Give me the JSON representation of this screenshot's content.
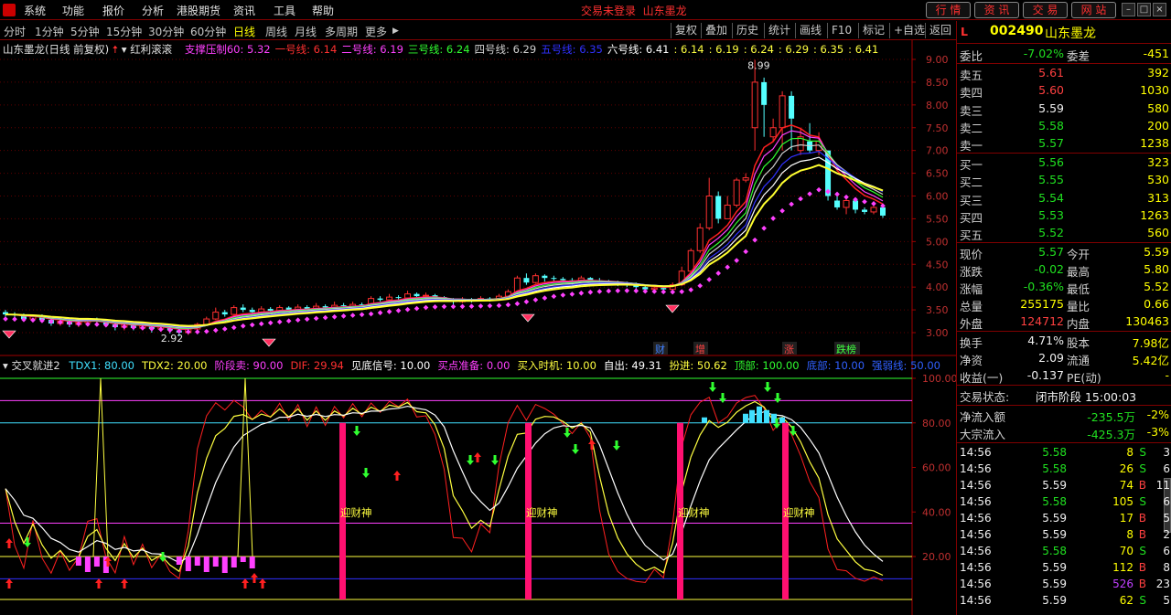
{
  "menu": [
    "系统",
    "功能",
    "报价",
    "分析",
    "港股期货",
    "资讯",
    "工具",
    "帮助"
  ],
  "login_status": "交易未登录",
  "login_stock": "山东墨龙",
  "top_buttons": [
    "行 情",
    "资 讯",
    "交 易",
    "网 站"
  ],
  "periods": [
    "分时",
    "1分钟",
    "5分钟",
    "15分钟",
    "30分钟",
    "60分钟",
    "日线",
    "周线",
    "月线",
    "多周期",
    "更多"
  ],
  "active_period": "日线",
  "tools": [
    "复权",
    "叠加",
    "历史",
    "统计",
    "画线",
    "F10",
    "标记",
    "+自选",
    "返回"
  ],
  "main_legend": {
    "name": "山东墨龙(日线 前复权)",
    "indicator": "红利滚滚",
    "items": [
      {
        "text": "支撑压制60: 5.32",
        "color": "#ff40ff"
      },
      {
        "text": "一号线: 6.14",
        "color": "#ff3030"
      },
      {
        "text": "二号线: 6.19",
        "color": "#ff40ff"
      },
      {
        "text": "三号线: 6.24",
        "color": "#30ff30"
      },
      {
        "text": "四号线: 6.29",
        "color": "#d0d0d0"
      },
      {
        "text": "五号线: 6.35",
        "color": "#3030ff"
      },
      {
        "text": "六号线: 6.41",
        "color": "#ffffff"
      },
      {
        "text": ": 6.14",
        "color": "#ffff40"
      },
      {
        "text": ": 6.19",
        "color": "#ffff40"
      },
      {
        "text": ": 6.24",
        "color": "#ffff40"
      },
      {
        "text": ": 6.29",
        "color": "#ffff40"
      },
      {
        "text": ": 6.35",
        "color": "#ffff40"
      },
      {
        "text": ": 6.41",
        "color": "#ffff40"
      }
    ]
  },
  "price_axis": [
    "9.00",
    "8.50",
    "8.00",
    "7.50",
    "7.00",
    "6.50",
    "6.00",
    "5.50",
    "5.00",
    "4.50",
    "4.00",
    "3.50",
    "3.00"
  ],
  "high_label": "8.99",
  "low_label": "2.92",
  "event_tags": [
    {
      "text": "财",
      "color": "#4080ff"
    },
    {
      "text": "增",
      "color": "#ff4040"
    },
    {
      "text": "涨",
      "color": "#ff4040"
    },
    {
      "text": "跌榜",
      "color": "#40ff40"
    }
  ],
  "sub_legend": {
    "name": "交叉就进2",
    "items": [
      {
        "text": "TDX1: 80.00",
        "color": "#40e0ff"
      },
      {
        "text": "TDX2: 20.00",
        "color": "#ffff40"
      },
      {
        "text": "阶段卖: 90.00",
        "color": "#ff40ff"
      },
      {
        "text": "DIF: 29.94",
        "color": "#ff3030"
      },
      {
        "text": "见底信号: 10.00",
        "color": "#ffffff"
      },
      {
        "text": "买点准备: 0.00",
        "color": "#ff40ff"
      },
      {
        "text": "买入时机: 10.00",
        "color": "#ffff40"
      },
      {
        "text": "自出: 49.31",
        "color": "#ffffff"
      },
      {
        "text": "扮进: 50.62",
        "color": "#ffff40"
      },
      {
        "text": "顶部: 100.00",
        "color": "#30ff30"
      },
      {
        "text": "底部: 10.00",
        "color": "#3060ff"
      },
      {
        "text": "强弱线: 50.00",
        "color": "#3060ff"
      }
    ]
  },
  "sub_axis": [
    "100.00",
    "80.00",
    "60.00",
    "40.00",
    "20.00"
  ],
  "signal_label": "迎财神",
  "stock": {
    "tag": "L",
    "code": "002490",
    "name": "山东墨龙"
  },
  "weibi": {
    "label": "委比",
    "value": "-7.02%",
    "label2": "委差",
    "value2": "-451"
  },
  "sell": [
    {
      "label": "卖五",
      "price": "5.61",
      "vol": "392"
    },
    {
      "label": "卖四",
      "price": "5.60",
      "vol": "1030"
    },
    {
      "label": "卖三",
      "price": "5.59",
      "vol": "580"
    },
    {
      "label": "卖二",
      "price": "5.58",
      "vol": "200"
    },
    {
      "label": "卖一",
      "price": "5.57",
      "vol": "1238"
    }
  ],
  "buy": [
    {
      "label": "买一",
      "price": "5.56",
      "vol": "323"
    },
    {
      "label": "买二",
      "price": "5.55",
      "vol": "530"
    },
    {
      "label": "买三",
      "price": "5.54",
      "vol": "313"
    },
    {
      "label": "买四",
      "price": "5.53",
      "vol": "1263"
    },
    {
      "label": "买五",
      "price": "5.52",
      "vol": "560"
    }
  ],
  "quote": [
    {
      "l1": "现价",
      "v1": "5.57",
      "c1": "green",
      "l2": "今开",
      "v2": "5.59",
      "c2": "white"
    },
    {
      "l1": "涨跌",
      "v1": "-0.02",
      "c1": "green",
      "l2": "最高",
      "v2": "5.80",
      "c2": "red"
    },
    {
      "l1": "涨幅",
      "v1": "-0.36%",
      "c1": "green",
      "l2": "最低",
      "v2": "5.52",
      "c2": "green"
    },
    {
      "l1": "总量",
      "v1": "255175",
      "c1": "yellow",
      "l2": "量比",
      "v2": "0.66",
      "c2": "yellow"
    },
    {
      "l1": "外盘",
      "v1": "124712",
      "c1": "red",
      "l2": "内盘",
      "v2": "130463",
      "c2": "green"
    }
  ],
  "fund": [
    {
      "l1": "换手",
      "v1": "4.71%",
      "l2": "股本",
      "v2": "7.98亿"
    },
    {
      "l1": "净资",
      "v1": "2.09",
      "l2": "流通",
      "v2": "5.42亿"
    },
    {
      "l1": "收益(一)",
      "v1": "-0.137",
      "l2": "PE(动)",
      "v2": "-"
    }
  ],
  "trade_status": {
    "label": "交易状态:",
    "value": "闭市阶段 15:00:03"
  },
  "flows": [
    {
      "label": "净流入额",
      "value": "-235.5万",
      "pct": "-2%"
    },
    {
      "label": "大宗流入",
      "value": "-425.3万",
      "pct": "-3%"
    }
  ],
  "ticks": [
    {
      "time": "14:56",
      "price": "5.58",
      "pc": "green",
      "vol": "8",
      "vc": "yellow",
      "bs": "S",
      "n": "3"
    },
    {
      "time": "14:56",
      "price": "5.58",
      "pc": "green",
      "vol": "26",
      "vc": "yellow",
      "bs": "S",
      "n": "6"
    },
    {
      "time": "14:56",
      "price": "5.59",
      "pc": "white",
      "vol": "74",
      "vc": "yellow",
      "bs": "B",
      "n": "11"
    },
    {
      "time": "14:56",
      "price": "5.58",
      "pc": "green",
      "vol": "105",
      "vc": "yellow",
      "bs": "S",
      "n": "6"
    },
    {
      "time": "14:56",
      "price": "5.59",
      "pc": "white",
      "vol": "17",
      "vc": "yellow",
      "bs": "B",
      "n": "5"
    },
    {
      "time": "14:56",
      "price": "5.59",
      "pc": "white",
      "vol": "8",
      "vc": "yellow",
      "bs": "B",
      "n": "2"
    },
    {
      "time": "14:56",
      "price": "5.58",
      "pc": "green",
      "vol": "70",
      "vc": "yellow",
      "bs": "S",
      "n": "6"
    },
    {
      "time": "14:56",
      "price": "5.59",
      "pc": "white",
      "vol": "112",
      "vc": "yellow",
      "bs": "B",
      "n": "8"
    },
    {
      "time": "14:56",
      "price": "5.59",
      "pc": "white",
      "vol": "526",
      "vc": "purple",
      "bs": "B",
      "n": "23"
    },
    {
      "time": "14:56",
      "price": "5.59",
      "pc": "white",
      "vol": "62",
      "vc": "yellow",
      "bs": "S",
      "n": "5"
    }
  ],
  "candles": [
    [
      3.45,
      3.4,
      3.5,
      3.35
    ],
    [
      3.4,
      3.38,
      3.45,
      3.32
    ],
    [
      3.38,
      3.3,
      3.42,
      3.25
    ],
    [
      3.3,
      3.35,
      3.38,
      3.26
    ],
    [
      3.35,
      3.28,
      3.4,
      3.22
    ],
    [
      3.28,
      3.2,
      3.32,
      3.15
    ],
    [
      3.2,
      3.25,
      3.3,
      3.15
    ],
    [
      3.25,
      3.18,
      3.28,
      3.12
    ],
    [
      3.18,
      3.22,
      3.28,
      3.12
    ],
    [
      3.22,
      3.28,
      3.32,
      3.18
    ],
    [
      3.28,
      3.25,
      3.33,
      3.2
    ],
    [
      3.25,
      3.18,
      3.3,
      3.12
    ],
    [
      3.18,
      3.12,
      3.22,
      3.05
    ],
    [
      3.12,
      3.18,
      3.2,
      3.05
    ],
    [
      3.18,
      3.1,
      3.22,
      3.05
    ],
    [
      3.1,
      3.15,
      3.2,
      3.05
    ],
    [
      3.15,
      3.08,
      3.18,
      3.0
    ],
    [
      3.08,
      3.12,
      3.18,
      3.02
    ],
    [
      3.12,
      3.05,
      3.15,
      2.98
    ],
    [
      3.05,
      3.0,
      3.1,
      2.92
    ],
    [
      3.0,
      3.08,
      3.12,
      2.95
    ],
    [
      3.08,
      3.18,
      3.22,
      3.05
    ],
    [
      3.18,
      3.3,
      3.35,
      3.15
    ],
    [
      3.3,
      3.45,
      3.55,
      3.28
    ],
    [
      3.45,
      3.4,
      3.5,
      3.35
    ],
    [
      3.4,
      3.55,
      3.6,
      3.38
    ],
    [
      3.55,
      3.5,
      3.62,
      3.45
    ],
    [
      3.5,
      3.45,
      3.55,
      3.4
    ],
    [
      3.45,
      3.52,
      3.58,
      3.42
    ],
    [
      3.52,
      3.48,
      3.56,
      3.42
    ],
    [
      3.48,
      3.55,
      3.6,
      3.45
    ],
    [
      3.55,
      3.5,
      3.58,
      3.45
    ],
    [
      3.5,
      3.56,
      3.62,
      3.48
    ],
    [
      3.56,
      3.52,
      3.6,
      3.48
    ],
    [
      3.52,
      3.58,
      3.65,
      3.5
    ],
    [
      3.58,
      3.55,
      3.62,
      3.5
    ],
    [
      3.55,
      3.6,
      3.68,
      3.52
    ],
    [
      3.6,
      3.58,
      3.65,
      3.55
    ],
    [
      3.58,
      3.62,
      3.68,
      3.55
    ],
    [
      3.62,
      3.6,
      3.66,
      3.56
    ],
    [
      3.6,
      3.75,
      3.8,
      3.58
    ],
    [
      3.75,
      3.72,
      3.8,
      3.68
    ],
    [
      3.72,
      3.78,
      3.85,
      3.7
    ],
    [
      3.78,
      3.76,
      3.82,
      3.7
    ],
    [
      3.76,
      3.85,
      3.92,
      3.74
    ],
    [
      3.85,
      3.8,
      3.88,
      3.75
    ],
    [
      3.8,
      3.82,
      3.88,
      3.76
    ],
    [
      3.82,
      3.78,
      3.85,
      3.72
    ],
    [
      3.78,
      3.72,
      3.8,
      3.68
    ],
    [
      3.72,
      3.68,
      3.76,
      3.62
    ],
    [
      3.68,
      3.72,
      3.78,
      3.65
    ],
    [
      3.72,
      3.7,
      3.76,
      3.66
    ],
    [
      3.7,
      3.75,
      3.8,
      3.68
    ],
    [
      3.75,
      3.72,
      3.78,
      3.68
    ],
    [
      3.72,
      3.8,
      3.85,
      3.7
    ],
    [
      3.8,
      3.9,
      3.95,
      3.78
    ],
    [
      3.9,
      4.2,
      4.25,
      3.88
    ],
    [
      4.2,
      4.1,
      4.3,
      4.05
    ],
    [
      4.1,
      4.25,
      4.3,
      4.08
    ],
    [
      4.25,
      4.2,
      4.28,
      4.12
    ],
    [
      4.2,
      4.18,
      4.25,
      4.12
    ],
    [
      4.18,
      4.15,
      4.22,
      4.1
    ],
    [
      4.15,
      4.12,
      4.2,
      4.05
    ],
    [
      4.12,
      4.2,
      4.25,
      4.1
    ],
    [
      4.2,
      4.15,
      4.22,
      4.1
    ],
    [
      4.15,
      4.12,
      4.2,
      4.08
    ],
    [
      4.12,
      4.1,
      4.16,
      4.05
    ],
    [
      4.1,
      4.08,
      4.14,
      4.02
    ],
    [
      4.08,
      4.05,
      4.12,
      4.0
    ],
    [
      4.05,
      4.0,
      4.1,
      3.95
    ],
    [
      4.0,
      3.95,
      4.02,
      3.9
    ],
    [
      3.95,
      3.98,
      4.02,
      3.92
    ],
    [
      3.98,
      3.95,
      4.0,
      3.9
    ],
    [
      3.95,
      4.05,
      4.1,
      3.92
    ],
    [
      4.05,
      4.35,
      4.45,
      4.02
    ],
    [
      4.35,
      4.8,
      4.85,
      4.3
    ],
    [
      4.8,
      5.3,
      5.4,
      4.75
    ],
    [
      5.3,
      6.0,
      6.4,
      5.25
    ],
    [
      6.0,
      5.5,
      6.1,
      5.4
    ],
    [
      5.5,
      5.8,
      6.0,
      5.5
    ],
    [
      5.8,
      6.35,
      6.4,
      5.75
    ],
    [
      6.35,
      6.4,
      6.5,
      6.3
    ],
    [
      7.5,
      8.5,
      8.99,
      7.0
    ],
    [
      8.5,
      8.0,
      8.6,
      7.3
    ],
    [
      7.3,
      7.5,
      7.7,
      7.2
    ],
    [
      7.5,
      8.2,
      8.3,
      7.0
    ],
    [
      8.2,
      7.7,
      8.3,
      7.0
    ],
    [
      7.0,
      7.3,
      7.5,
      6.9
    ],
    [
      7.2,
      7.0,
      7.6,
      6.95
    ],
    [
      7.0,
      7.2,
      7.4,
      6.9
    ],
    [
      7.0,
      6.0,
      7.0,
      5.9
    ],
    [
      5.9,
      5.75,
      6.05,
      5.7
    ],
    [
      5.75,
      5.9,
      6.0,
      5.6
    ],
    [
      5.9,
      5.7,
      5.95,
      5.62
    ],
    [
      5.7,
      5.65,
      5.75,
      5.6
    ],
    [
      5.65,
      5.75,
      5.8,
      5.6
    ],
    [
      5.75,
      5.57,
      5.8,
      5.52
    ]
  ]
}
